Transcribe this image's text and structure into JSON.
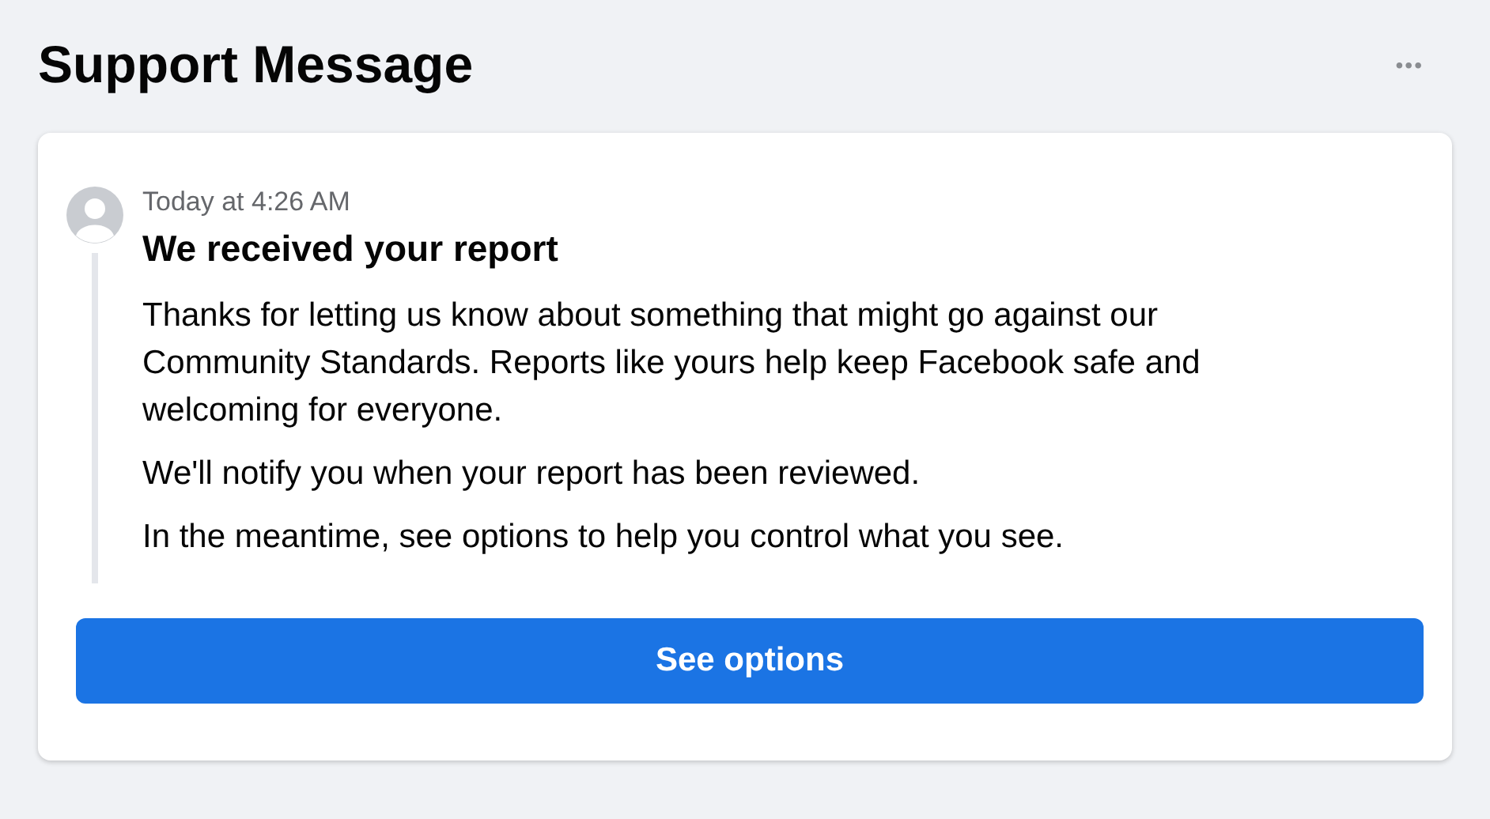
{
  "header": {
    "title": "Support Message",
    "more_label": "•••"
  },
  "message": {
    "timestamp": "Today at 4:26 AM",
    "title": "We received your report",
    "paragraphs": [
      "Thanks for letting us know about something that might go against our Community Standards. Reports like yours help keep Facebook safe and welcoming for everyone.",
      "We'll notify you when your report has been reviewed.",
      "In the meantime, see options to help you control what you see."
    ],
    "button": "See options"
  }
}
